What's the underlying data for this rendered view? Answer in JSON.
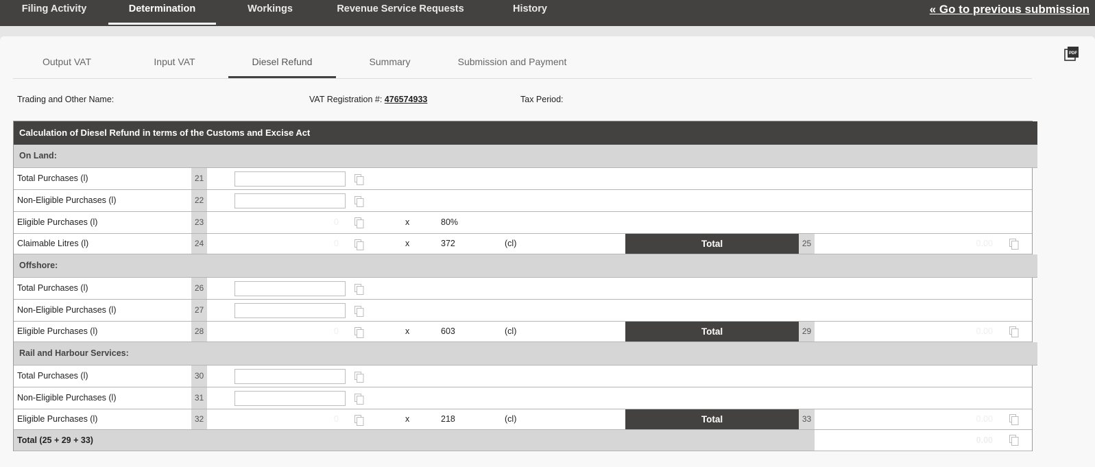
{
  "topnav": {
    "items": [
      {
        "label": "Filing Activity"
      },
      {
        "label": "Determination"
      },
      {
        "label": "Workings"
      },
      {
        "label": "Revenue Service Requests"
      },
      {
        "label": "History"
      }
    ],
    "active": "Determination",
    "prev_link": "« Go to previous submission"
  },
  "subtabs": {
    "items": [
      {
        "label": "Output VAT"
      },
      {
        "label": "Input VAT"
      },
      {
        "label": "Diesel Refund"
      },
      {
        "label": "Summary"
      },
      {
        "label": "Submission and Payment"
      }
    ],
    "active": "Diesel Refund"
  },
  "pdf_icon": "pdf-icon",
  "info": {
    "trading_label": "Trading and Other Name:",
    "trading_value": "",
    "vat_label": "VAT Registration #:",
    "vat_value": "476574933",
    "tax_period_label": "Tax Period:",
    "tax_period_value": ""
  },
  "table": {
    "title": "Calculation of Diesel Refund in terms of the Customs and Excise Act",
    "total_label": "Total",
    "x_symbol": "x",
    "sections": [
      {
        "title": "On Land:",
        "rows": [
          {
            "label": "Total Purchases (l)",
            "num": "21",
            "value": ""
          },
          {
            "label": "Non-Eligible Purchases (l)",
            "num": "22",
            "value": ""
          },
          {
            "label": "Eligible Purchases (l)",
            "num": "23",
            "value": "0",
            "factor": "80%"
          },
          {
            "label": "Claimable Litres (l)",
            "num": "24",
            "value": "0",
            "factor": "372",
            "unit": "(cl)",
            "total_num": "25",
            "total_value": "0.00"
          }
        ]
      },
      {
        "title": "Offshore:",
        "rows": [
          {
            "label": "Total Purchases (l)",
            "num": "26",
            "value": ""
          },
          {
            "label": "Non-Eligible Purchases (l)",
            "num": "27",
            "value": ""
          },
          {
            "label": "Eligible Purchases (l)",
            "num": "28",
            "value": "0",
            "factor": "603",
            "unit": "(cl)",
            "total_num": "29",
            "total_value": "0.00"
          }
        ]
      },
      {
        "title": "Rail and Harbour Services:",
        "rows": [
          {
            "label": "Total Purchases (l)",
            "num": "30",
            "value": ""
          },
          {
            "label": "Non-Eligible Purchases (l)",
            "num": "31",
            "value": ""
          },
          {
            "label": "Eligible Purchases (l)",
            "num": "32",
            "value": "0",
            "factor": "218",
            "unit": "(cl)",
            "total_num": "33",
            "total_value": "0.00"
          }
        ]
      }
    ],
    "grand_total": {
      "label": "Total (25 + 29 + 33)",
      "value": "0.00"
    }
  },
  "icons": {
    "copy": "copy-icon",
    "pdf": "pdf-icon"
  }
}
